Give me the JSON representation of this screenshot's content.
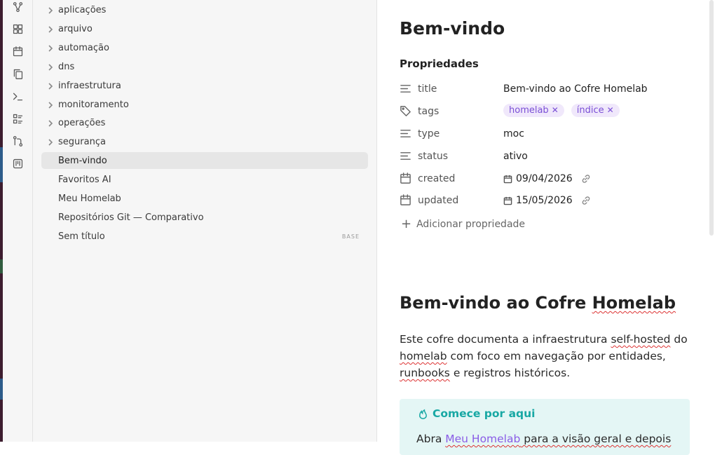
{
  "sidebar": {
    "folders": [
      {
        "label": "aplicações"
      },
      {
        "label": "arquivo"
      },
      {
        "label": "automação"
      },
      {
        "label": "dns"
      },
      {
        "label": "infraestrutura"
      },
      {
        "label": "monitoramento"
      },
      {
        "label": "operações"
      },
      {
        "label": "segurança"
      }
    ],
    "files": [
      {
        "label": "Bem-vindo",
        "active": true
      },
      {
        "label": "Favoritos AI"
      },
      {
        "label": "Meu Homelab"
      },
      {
        "label": "Repositórios Git — Comparativo"
      },
      {
        "label": "Sem título",
        "badge": "BASE"
      }
    ]
  },
  "ribbon": {
    "icons": [
      "graph-icon",
      "blocks-icon",
      "calendar-icon",
      "copy-icon",
      "terminal-icon",
      "list-icon",
      "git-icon",
      "kanban-icon"
    ]
  },
  "note": {
    "title": "Bem-vindo",
    "properties_heading": "Propriedades",
    "properties": [
      {
        "name": "title",
        "icon": "text-lines-icon",
        "value": "Bem-vindo ao Cofre Homelab"
      },
      {
        "name": "tags",
        "icon": "tag-icon",
        "tags": [
          "homelab",
          "índice"
        ]
      },
      {
        "name": "type",
        "icon": "text-lines-icon",
        "value": "moc"
      },
      {
        "name": "status",
        "icon": "text-lines-icon",
        "value": "ativo"
      },
      {
        "name": "created",
        "icon": "calendar-icon",
        "date": "09/04/2026"
      },
      {
        "name": "updated",
        "icon": "calendar-icon",
        "date": "15/05/2026"
      }
    ],
    "add_property": "Adicionar propriedade",
    "heading": {
      "part1": "Bem-vindo ao Cofre ",
      "part2": "Homelab"
    },
    "paragraph": {
      "t1": "Este cofre documenta a infraestrutura ",
      "t2": "self-hosted",
      "t3": " do ",
      "t4": "homelab",
      "t5": " com foco em navegação por entidades, ",
      "t6": "runbooks",
      "t7": " e registros históricos."
    },
    "callout": {
      "title": "Comece por aqui",
      "t1": "Abra ",
      "link": "Meu Homelab",
      "t2": " para a visão geral e depois"
    }
  },
  "colors": {
    "accent": "#8a5ce6",
    "callout": "#18a8a4",
    "callout_bg": "#e4f6f5",
    "tag_bg": "#f0e8fb"
  }
}
